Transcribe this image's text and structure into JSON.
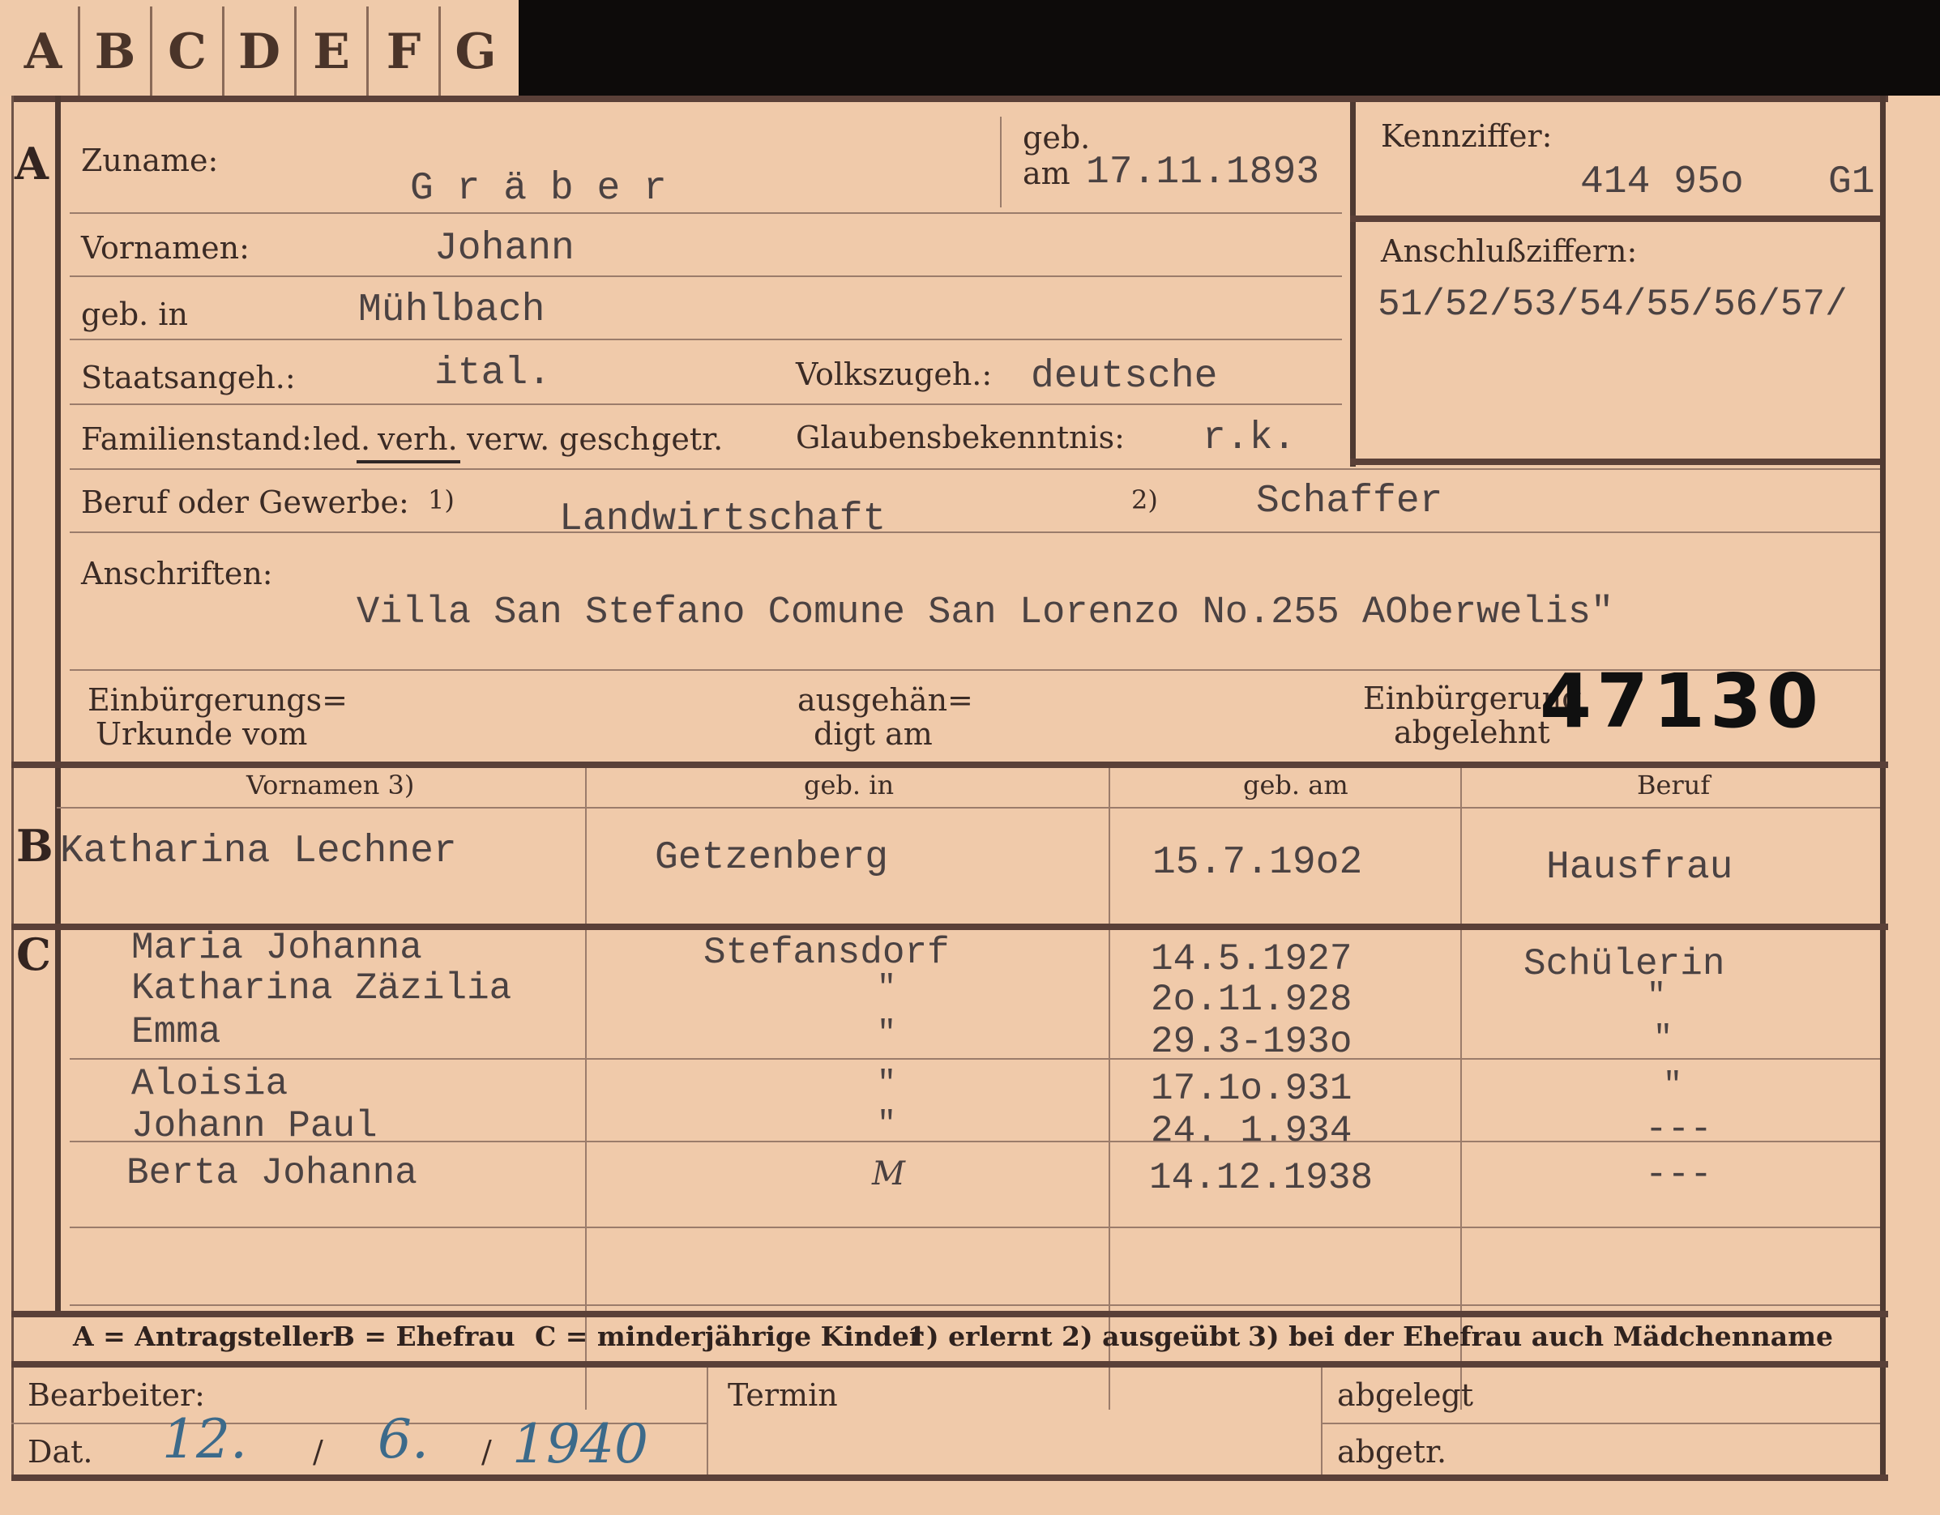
{
  "tabs": [
    "A",
    "B",
    "C",
    "D",
    "E",
    "F",
    "G"
  ],
  "sections": {
    "a": "A",
    "b": "B",
    "c": "C"
  },
  "applicant": {
    "surname_label": "Zuname:",
    "surname": "G r ä b e r",
    "geb_label": "geb.",
    "am_label": "am",
    "birth_date": "17.11.1893",
    "id_label": "Kennziffer:",
    "id_number": "414 95o",
    "id_suffix": "G1",
    "forenames_label": "Vornamen:",
    "forenames": "Johann",
    "birthplace_label": "geb. in",
    "birthplace": "Mühlbach",
    "related_label": "Anschlußziffern:",
    "related_numbers": "51/52/53/54/55/56/57/",
    "citizenship_label": "Staatsangeh.:",
    "citizenship": "ital.",
    "ethnicity_label": "Volkszugeh.:",
    "ethnicity": "deutsche",
    "marital_label": "Familienstand:",
    "marital_options": [
      "led.",
      "verh.",
      "verw.",
      "gesch.",
      "getr."
    ],
    "marital_selected": "verh.",
    "religion_label": "Glaubensbekenntnis:",
    "religion": "r.k.",
    "occupation_label": "Beruf oder Gewerbe:",
    "occ_mark_1": "1)",
    "occupation_1": "Landwirtschaft",
    "occ_mark_2": "2)",
    "occupation_2": "Schaffer",
    "address_label": "Anschriften:",
    "address": "Villa San Stefano Comune San Lorenzo No.255 AOberwelis\"",
    "naturalization_label_1": "Einbürgerungs=",
    "naturalization_label_2": "Urkunde vom",
    "issued_label_1": "ausgehän=",
    "issued_label_2": "digt am",
    "rejected_label_1": "Einbürgerung",
    "rejected_label_2": "abgelehnt",
    "stamp_number": "47130"
  },
  "columns": {
    "names": "Vornamen 3)",
    "born_in": "geb. in",
    "born_on": "geb. am",
    "occupation": "Beruf"
  },
  "spouse": {
    "name": "Katharina Lechner",
    "born_in": "Getzenberg",
    "born_on": "15.7.19o2",
    "occupation": "Hausfrau"
  },
  "children": [
    {
      "name": "Maria Johanna",
      "born_in": "Stefansdorf",
      "born_on": "14.5.1927",
      "occupation": "Schülerin"
    },
    {
      "name": "Katharina Zäzilia",
      "born_in": "\"",
      "born_on": "2o.11.928",
      "occupation": "\""
    },
    {
      "name": "Emma",
      "born_in": "\"",
      "born_on": "29.3-193o",
      "occupation": "\""
    },
    {
      "name": "Aloisia",
      "born_in": "\"",
      "born_on": "17.1o.931",
      "occupation": "\""
    },
    {
      "name": "Johann Paul",
      "born_in": "\"",
      "born_on": "24. 1.934",
      "occupation": "---"
    },
    {
      "name": "Berta Johanna",
      "born_in": "M",
      "born_on": "14.12.1938",
      "occupation": "---"
    }
  ],
  "legend": {
    "a": "A = Antragsteller",
    "b": "B = Ehefrau",
    "c": "C = minderjährige Kinder",
    "n1": "1) erlernt",
    "n2": "2) ausgeübt",
    "n3": "3) bei der Ehefrau auch Mädchenname"
  },
  "footer": {
    "clerk_label": "Bearbeiter:",
    "date_label": "Dat.",
    "date_day": "12.",
    "date_month": "6.",
    "date_year": "1940",
    "sep": "/",
    "appointment_label": "Termin",
    "filed_label": "abgelegt",
    "submitted_label": "abgetr."
  }
}
